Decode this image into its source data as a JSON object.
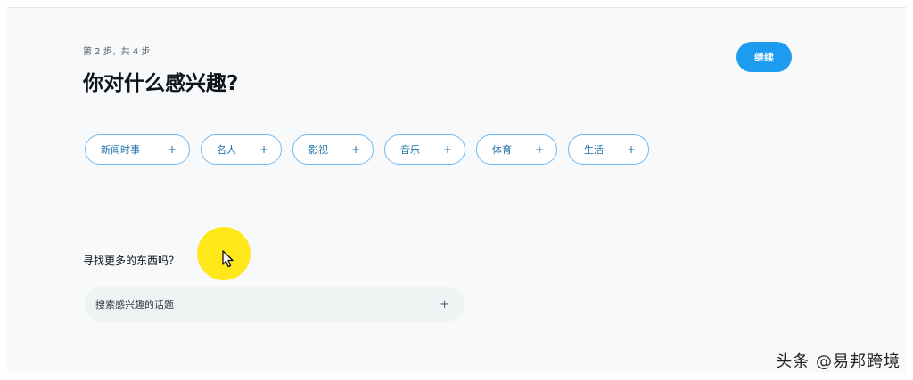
{
  "header": {
    "step": "第 2 步，共 4 步",
    "title": "你对什么感兴趣?",
    "continue_label": "继续"
  },
  "topics": [
    {
      "label": "新闻时事",
      "icon": "plus-icon"
    },
    {
      "label": "名人",
      "icon": "plus-icon"
    },
    {
      "label": "影视",
      "icon": "plus-icon"
    },
    {
      "label": "音乐",
      "icon": "plus-icon"
    },
    {
      "label": "体育",
      "icon": "plus-icon"
    },
    {
      "label": "生活",
      "icon": "plus-icon"
    }
  ],
  "search": {
    "prompt": "寻找更多的东西吗？",
    "placeholder": "搜索感兴趣的话题",
    "icon": "plus-icon"
  },
  "watermark": "头条 @易邦跨境",
  "colors": {
    "accent": "#1d9bf0",
    "chip_border": "#6fb8f2",
    "highlight": "#ffe600",
    "background": "#f7f9fa"
  }
}
